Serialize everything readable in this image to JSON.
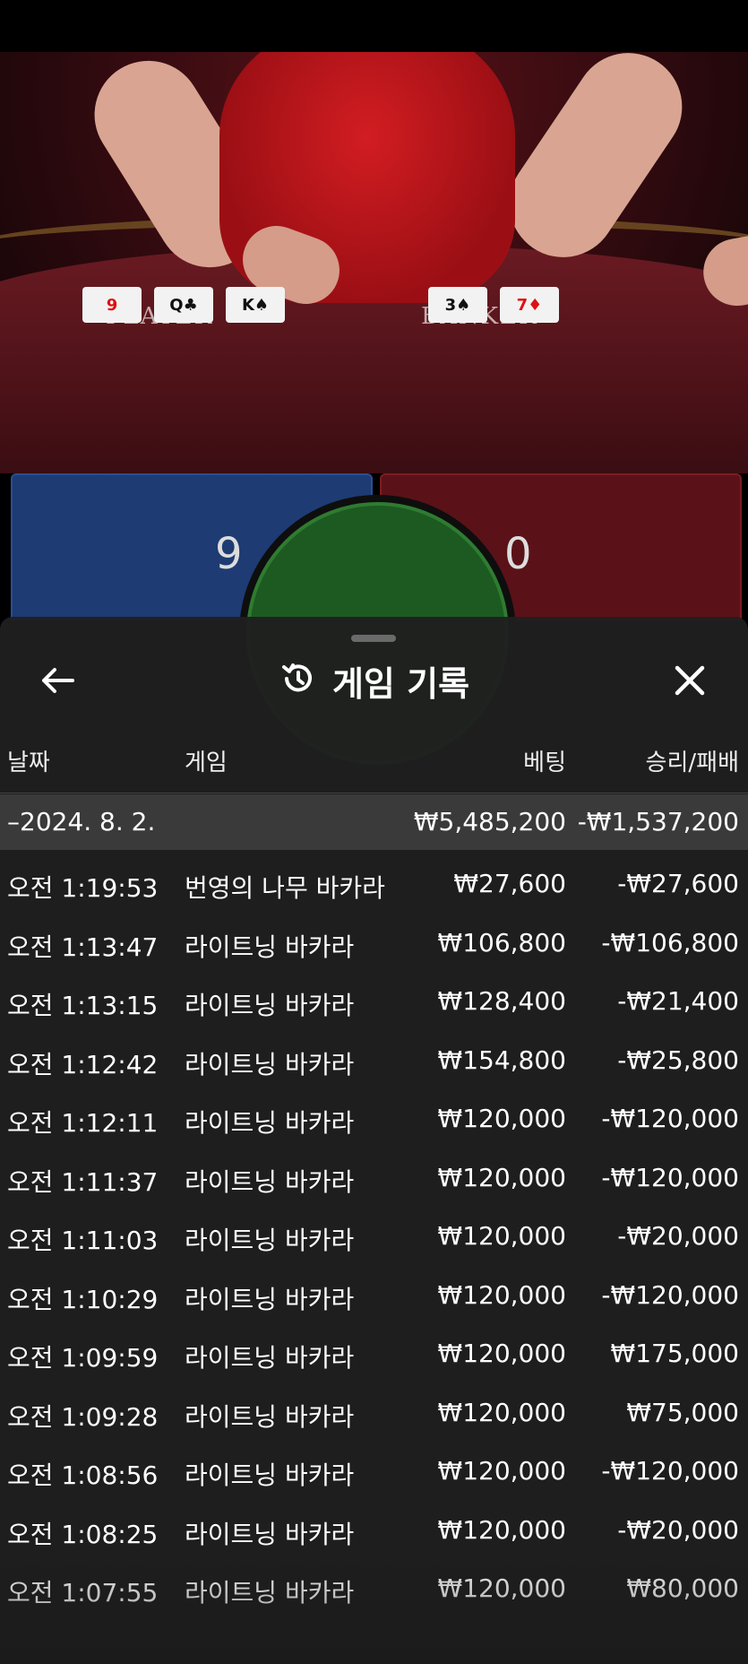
{
  "table": {
    "player_label": "PLAYER",
    "banker_label": "BANKER",
    "player_cards": [
      {
        "text": "9",
        "color": "red"
      },
      {
        "text": "Q♣",
        "color": "blk"
      },
      {
        "text": "K♠",
        "color": "blk"
      }
    ],
    "banker_cards": [
      {
        "text": "3♠",
        "color": "blk"
      },
      {
        "text": "7♦",
        "color": "red"
      }
    ],
    "player_score": "9",
    "banker_score": "0"
  },
  "sheet": {
    "title": "게임 기록",
    "icons": {
      "back": "arrow-left-icon",
      "history": "history-icon",
      "close": "close-icon"
    },
    "columns": {
      "date": "날짜",
      "game": "게임",
      "bet": "베팅",
      "win": "승리/패배"
    },
    "summary": {
      "date": "–2024. 8. 2.",
      "bet": "₩5,485,200",
      "win": "-₩1,537,200"
    },
    "rows": [
      {
        "date": "오전 1:19:53",
        "game": "번영의 나무 바카라",
        "bet": "₩27,600",
        "win": "-₩27,600"
      },
      {
        "date": "오전 1:13:47",
        "game": "라이트닝 바카라",
        "bet": "₩106,800",
        "win": "-₩106,800"
      },
      {
        "date": "오전 1:13:15",
        "game": "라이트닝 바카라",
        "bet": "₩128,400",
        "win": "-₩21,400"
      },
      {
        "date": "오전 1:12:42",
        "game": "라이트닝 바카라",
        "bet": "₩154,800",
        "win": "-₩25,800"
      },
      {
        "date": "오전 1:12:11",
        "game": "라이트닝 바카라",
        "bet": "₩120,000",
        "win": "-₩120,000"
      },
      {
        "date": "오전 1:11:37",
        "game": "라이트닝 바카라",
        "bet": "₩120,000",
        "win": "-₩120,000"
      },
      {
        "date": "오전 1:11:03",
        "game": "라이트닝 바카라",
        "bet": "₩120,000",
        "win": "-₩20,000"
      },
      {
        "date": "오전 1:10:29",
        "game": "라이트닝 바카라",
        "bet": "₩120,000",
        "win": "-₩120,000"
      },
      {
        "date": "오전 1:09:59",
        "game": "라이트닝 바카라",
        "bet": "₩120,000",
        "win": "₩175,000"
      },
      {
        "date": "오전 1:09:28",
        "game": "라이트닝 바카라",
        "bet": "₩120,000",
        "win": "₩75,000"
      },
      {
        "date": "오전 1:08:56",
        "game": "라이트닝 바카라",
        "bet": "₩120,000",
        "win": "-₩120,000"
      },
      {
        "date": "오전 1:08:25",
        "game": "라이트닝 바카라",
        "bet": "₩120,000",
        "win": "-₩20,000"
      },
      {
        "date": "오전 1:07:55",
        "game": "라이트닝 바카라",
        "bet": "₩120,000",
        "win": "₩80,000"
      }
    ]
  }
}
